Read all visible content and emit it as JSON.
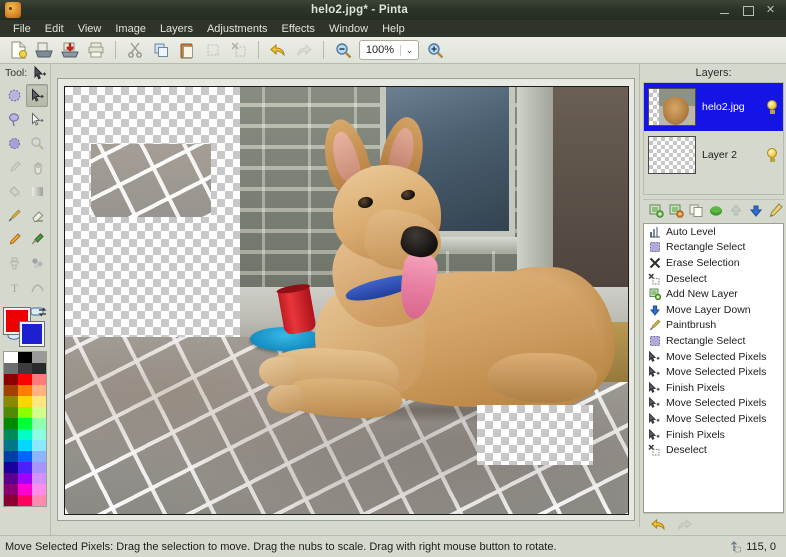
{
  "window": {
    "title": "helo2.jpg* - Pinta",
    "app_icon": "palette-icon",
    "minimize_label": "–",
    "maximize_label": "□",
    "close_label": "✕"
  },
  "menubar": {
    "items": [
      {
        "label": "File"
      },
      {
        "label": "Edit"
      },
      {
        "label": "View"
      },
      {
        "label": "Image"
      },
      {
        "label": "Layers"
      },
      {
        "label": "Adjustments"
      },
      {
        "label": "Effects"
      },
      {
        "label": "Window"
      },
      {
        "label": "Help"
      }
    ]
  },
  "toolbar": {
    "buttons": [
      {
        "name": "new-file-icon",
        "title": "New"
      },
      {
        "name": "open-file-icon",
        "title": "Open"
      },
      {
        "name": "save-file-icon",
        "title": "Save"
      },
      {
        "name": "print-icon",
        "title": "Print"
      },
      {
        "name": "cut-icon",
        "title": "Cut"
      },
      {
        "name": "copy-icon",
        "title": "Copy"
      },
      {
        "name": "paste-icon",
        "title": "Paste"
      },
      {
        "name": "crop-icon",
        "title": "Crop to Selection"
      },
      {
        "name": "deselect-icon",
        "title": "Deselect All"
      },
      {
        "name": "undo-icon",
        "title": "Undo"
      },
      {
        "name": "redo-icon",
        "title": "Redo"
      },
      {
        "name": "zoom-out-icon",
        "title": "Zoom Out"
      },
      {
        "name": "zoom-in-icon",
        "title": "Zoom In"
      }
    ],
    "zoom_value": "100%",
    "zoom_dropdown_glyph": "⌄"
  },
  "tools": {
    "label": "Tool:",
    "active": "move-selected-icon",
    "items": [
      {
        "name": "ellipse-select-icon",
        "selected": false
      },
      {
        "name": "move-selected-icon",
        "selected": true
      },
      {
        "name": "lasso-select-icon",
        "selected": false
      },
      {
        "name": "move-selection-icon",
        "selected": false
      },
      {
        "name": "magic-wand-icon",
        "selected": false
      },
      {
        "name": "zoom-tool-icon",
        "selected": false
      },
      {
        "name": "color-picker-icon",
        "selected": false
      },
      {
        "name": "pan-icon",
        "selected": false
      },
      {
        "name": "paint-bucket-icon",
        "selected": false
      },
      {
        "name": "gradient-icon",
        "selected": false
      },
      {
        "name": "paintbrush-icon",
        "selected": false
      },
      {
        "name": "eraser-icon",
        "selected": false
      },
      {
        "name": "pencil-icon",
        "selected": false
      },
      {
        "name": "color-picker-2-icon",
        "selected": false
      },
      {
        "name": "clone-stamp-icon",
        "selected": false
      },
      {
        "name": "recolor-icon",
        "selected": false
      },
      {
        "name": "text-icon",
        "selected": false
      },
      {
        "name": "line-curve-icon",
        "selected": false
      },
      {
        "name": "rectangle-icon",
        "selected": false
      },
      {
        "name": "rounded-rectangle-icon",
        "selected": false
      },
      {
        "name": "ellipse-icon",
        "selected": false
      },
      {
        "name": "freeform-shape-icon",
        "selected": false
      }
    ]
  },
  "palette": {
    "primary_color": "#ee0000",
    "secondary_color": "#1f1fd2",
    "swap_glyph": "⇄",
    "swatches": [
      "#ffffff",
      "#000000",
      "#9a9a9a",
      "#6e6e6e",
      "#3c3c3c",
      "#2a2a2a",
      "#8d0000",
      "#ff0000",
      "#ff7a7a",
      "#a34000",
      "#ff7e00",
      "#ffb380",
      "#8a8a00",
      "#ffd400",
      "#ffe680",
      "#4f8a00",
      "#8cff00",
      "#d2ff8c",
      "#008a00",
      "#00ff3c",
      "#90ffb0",
      "#008a5a",
      "#00ffc4",
      "#8cffe0",
      "#00788a",
      "#00d8ff",
      "#8ce8ff",
      "#003fa3",
      "#0066ff",
      "#8cb4ff",
      "#1a009a",
      "#4b22ff",
      "#a894ff",
      "#5a0090",
      "#a200ff",
      "#d291ff",
      "#8a0070",
      "#ff00d4",
      "#ff8ceb",
      "#8a0030",
      "#ff0060",
      "#ff8cb0"
    ]
  },
  "canvas": {
    "image_name": "helo2.jpg",
    "has_transparent_regions": true,
    "floating_selection": "brick-patch"
  },
  "layers_panel": {
    "title": "Layers:",
    "layers": [
      {
        "name": "helo2.jpg",
        "visible": true,
        "selected": true,
        "thumb": "photo-thumb"
      },
      {
        "name": "Layer 2",
        "visible": true,
        "selected": false,
        "thumb": "empty-thumb"
      }
    ],
    "toolbar_buttons": [
      {
        "name": "add-new-layer-icon",
        "title": "Add New Layer"
      },
      {
        "name": "delete-layer-icon",
        "title": "Delete Layer"
      },
      {
        "name": "duplicate-layer-icon",
        "title": "Duplicate Layer"
      },
      {
        "name": "merge-layer-down-icon",
        "title": "Merge Layer Down"
      },
      {
        "name": "move-layer-up-icon",
        "title": "Move Layer Up"
      },
      {
        "name": "move-layer-down-icon",
        "title": "Move Layer Down"
      },
      {
        "name": "layer-properties-icon",
        "title": "Layer Properties"
      }
    ]
  },
  "history_panel": {
    "items": [
      {
        "label": "Auto Level",
        "icon": "auto-level-icon"
      },
      {
        "label": "Rectangle Select",
        "icon": "rectangle-select-icon"
      },
      {
        "label": "Erase Selection",
        "icon": "erase-selection-icon"
      },
      {
        "label": "Deselect",
        "icon": "deselect-icon"
      },
      {
        "label": "Add New Layer",
        "icon": "add-new-layer-icon"
      },
      {
        "label": "Move Layer Down",
        "icon": "move-layer-down-icon"
      },
      {
        "label": "Paintbrush",
        "icon": "paintbrush-icon"
      },
      {
        "label": "Rectangle Select",
        "icon": "rectangle-select-icon"
      },
      {
        "label": "Move Selected Pixels",
        "icon": "move-selected-icon"
      },
      {
        "label": "Move Selected Pixels",
        "icon": "move-selected-icon"
      },
      {
        "label": "Finish Pixels",
        "icon": "move-selected-icon"
      },
      {
        "label": "Move Selected Pixels",
        "icon": "move-selected-icon"
      },
      {
        "label": "Move Selected Pixels",
        "icon": "move-selected-icon"
      },
      {
        "label": "Finish Pixels",
        "icon": "move-selected-icon"
      },
      {
        "label": "Deselect",
        "icon": "deselect-icon"
      }
    ],
    "undo_label": "Undo",
    "redo_label": "Redo"
  },
  "statusbar": {
    "message": "Move Selected Pixels: Drag the selection to move. Drag the nubs to scale. Drag with right mouse button to rotate.",
    "cursor_icon": "cursor-position-icon",
    "coordinates": "115, 0"
  }
}
